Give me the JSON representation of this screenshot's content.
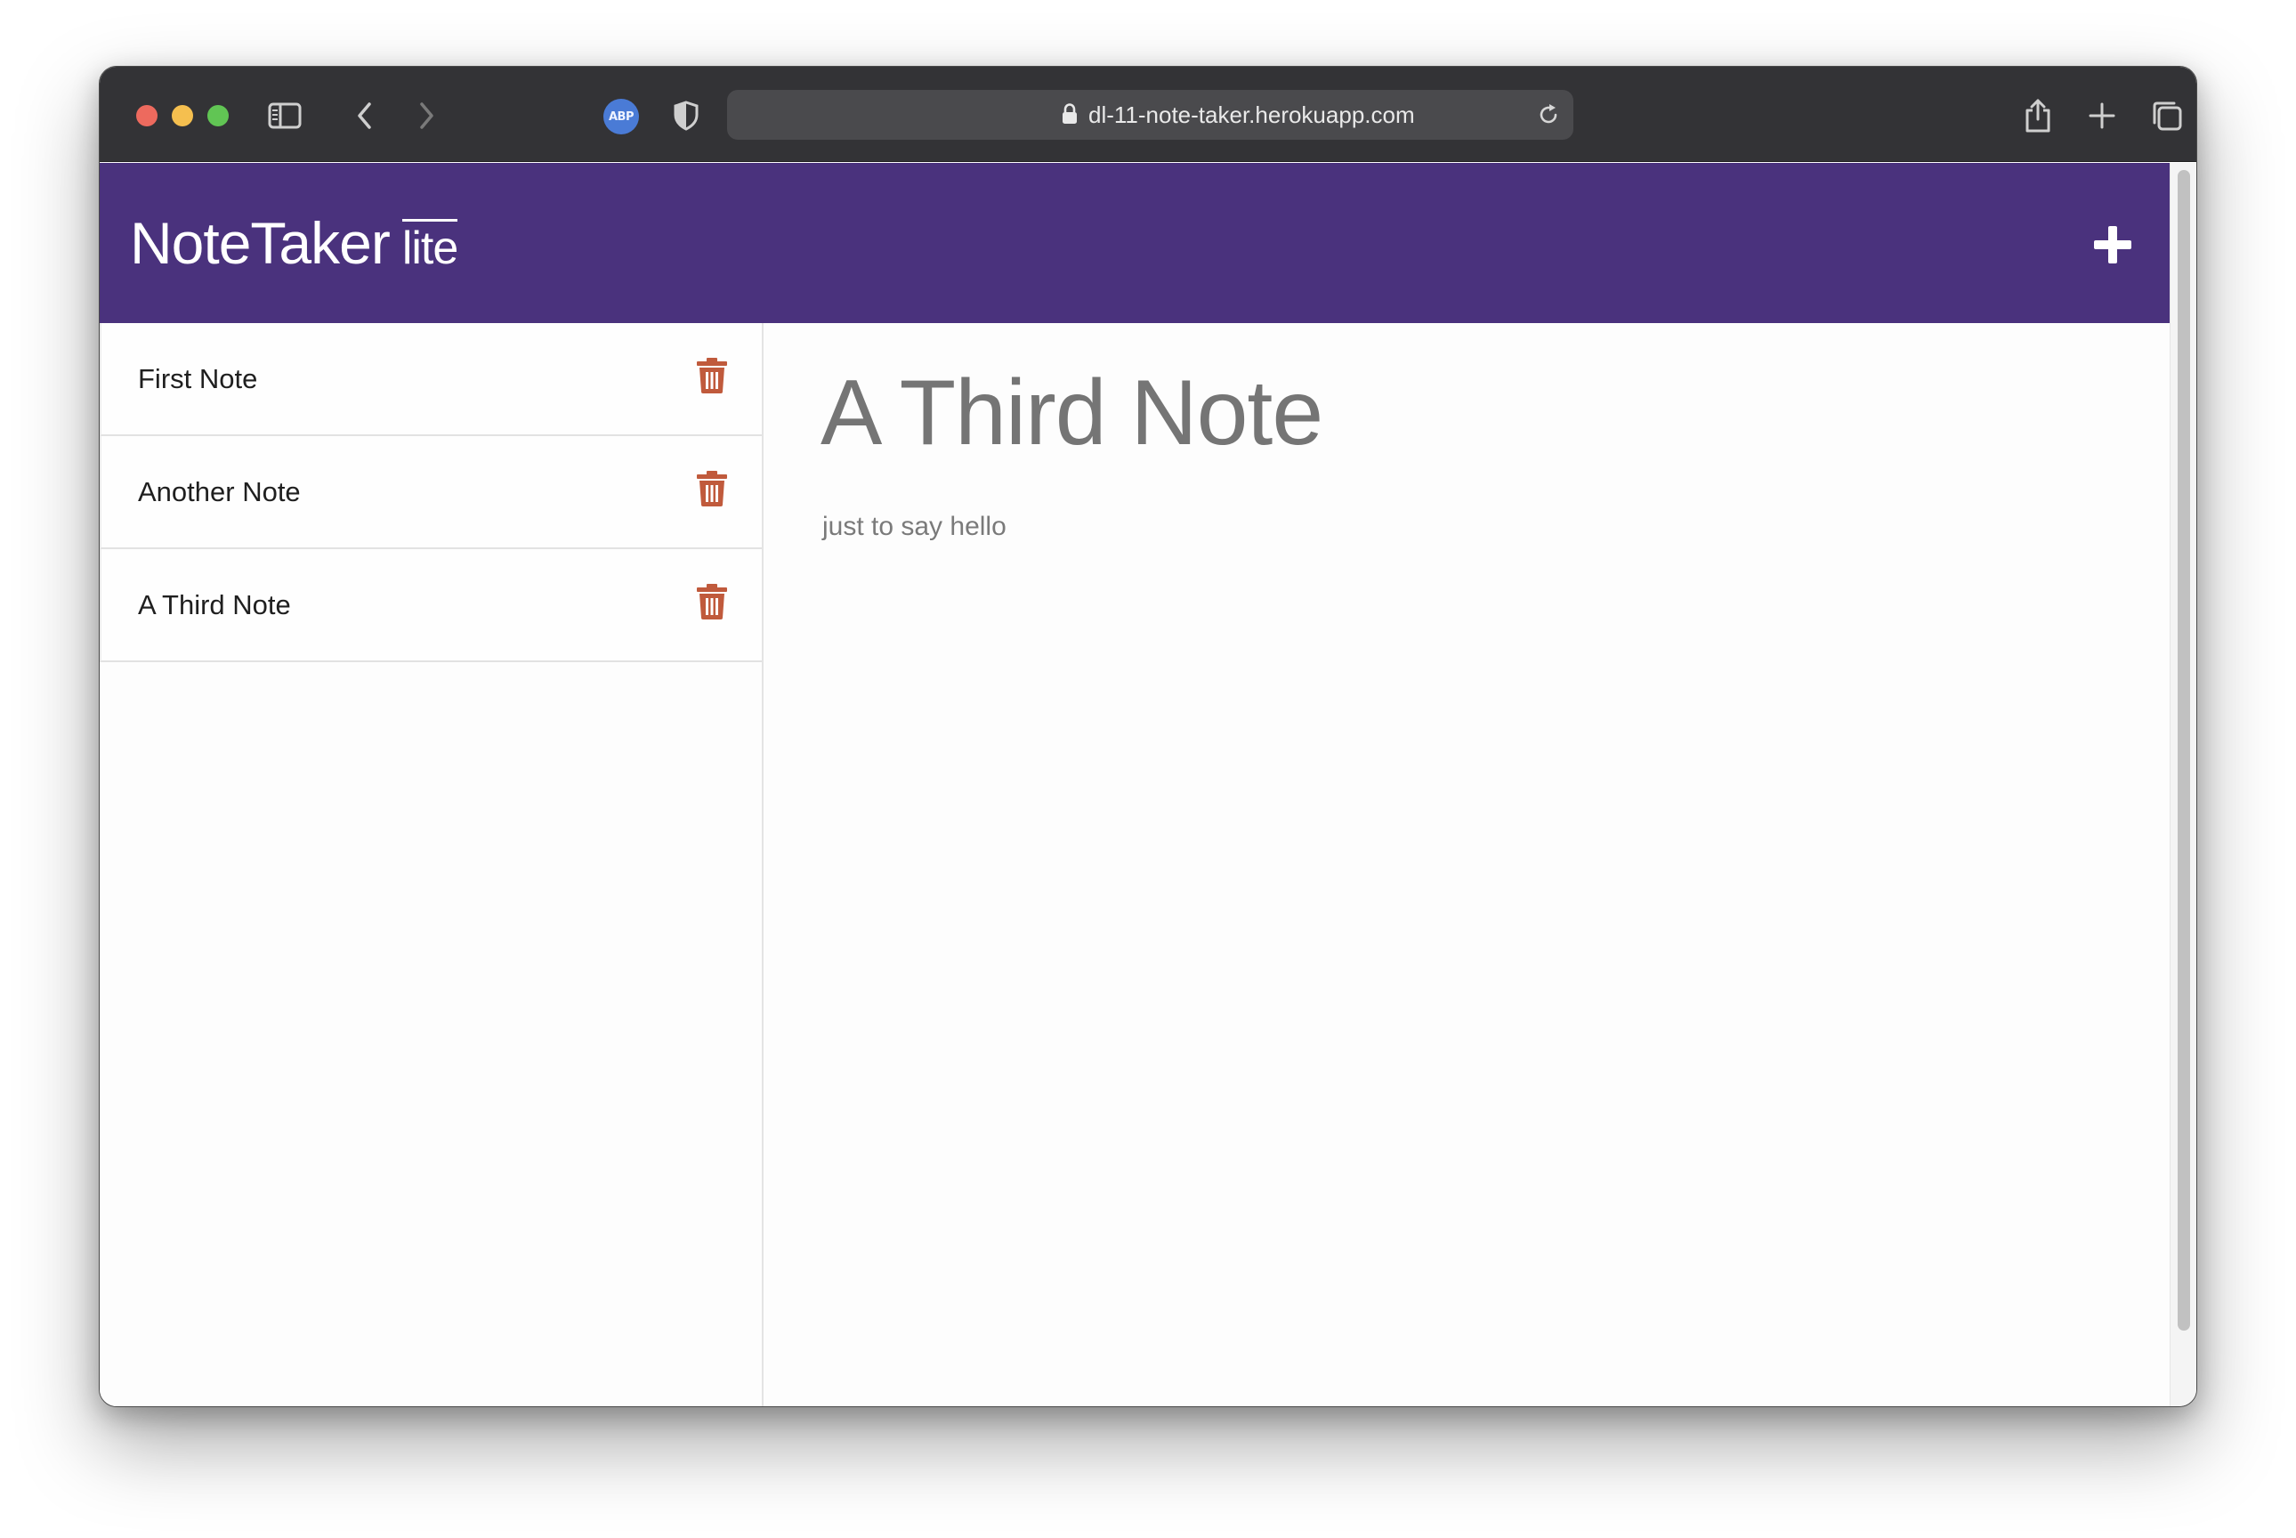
{
  "browser": {
    "url": "dl-11-note-taker.herokuapp.com",
    "extension_badge": "ABP",
    "icons": {
      "sidebar": "sidebar-toggle-icon",
      "back": "chevron-left-icon",
      "forward": "chevron-right-icon",
      "privacy": "shield-icon",
      "lock": "lock-icon",
      "reload": "reload-icon",
      "share": "share-icon",
      "new_tab": "plus-icon",
      "tabs": "tab-overview-icon"
    }
  },
  "app": {
    "brand": "NoteTaker",
    "brand_suffix": "lite",
    "new_note_icon": "plus-icon",
    "colors": {
      "navbar": "#4a327d",
      "trash": "#c05a3c"
    }
  },
  "notes": [
    {
      "title": "First Note"
    },
    {
      "title": "Another Note"
    },
    {
      "title": "A Third Note"
    }
  ],
  "active_note": {
    "title": "A Third Note",
    "text": "just to say hello"
  }
}
